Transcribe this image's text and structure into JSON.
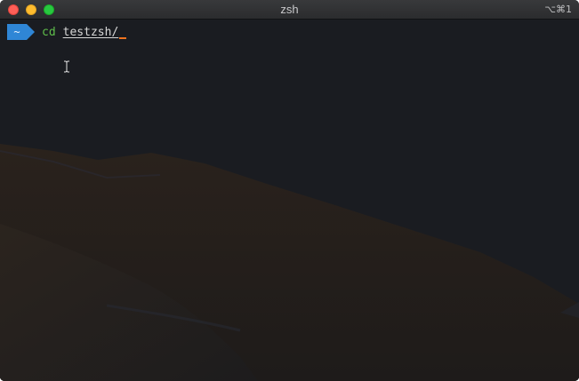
{
  "window": {
    "title": "zsh",
    "shortcut": "⌥⌘1"
  },
  "terminal": {
    "prompt_symbol": "~",
    "command": "cd",
    "argument": "testzsh/"
  },
  "colors": {
    "prompt_badge": "#2f86d6",
    "command": "#5fbf4b",
    "cursor": "#f0731e",
    "background": "#1b1d22"
  },
  "icons": [
    "close-button",
    "minimize-button",
    "maximize-button",
    "ibeam-cursor-icon"
  ]
}
